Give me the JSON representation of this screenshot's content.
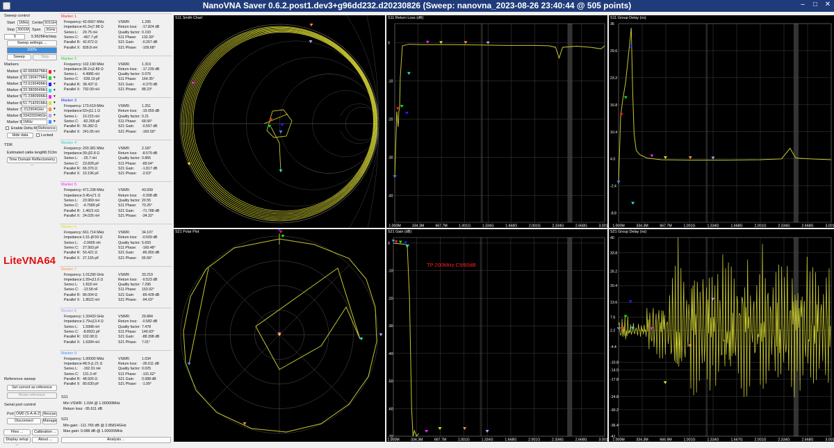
{
  "window": {
    "title": "NanoVNA Saver 0.6.2.post1.dev3+g96dd232.d20230826 (Sweep: nanovna_2023-08-26 23:40:44 @ 505 points)"
  },
  "sweep": {
    "section_label": "Sweep control",
    "start_label": "Start",
    "start_value": "1MHz",
    "center_label": "Center",
    "center_value": "501GHz",
    "stop_label": "Stop",
    "stop_value": "3001MH",
    "span_label": "Span",
    "span_value": "3GHz",
    "count_value": "5",
    "step_value": "5.952MHz/step",
    "settings_button": "Sweep settings ...",
    "progress_text": "100%",
    "progress_fraction": 1.0,
    "sweep_button": "Sweep",
    "stop_button": "Stop"
  },
  "markers_panel": {
    "section_label": "Markers",
    "rows": [
      {
        "label": "Marker 1",
        "value": "42.666667MHz",
        "color": "#ff2020"
      },
      {
        "label": "Marker 2",
        "value": "32.190477MHz",
        "color": "#20e020"
      },
      {
        "label": "Marker 3",
        "value": "73.619049MHz",
        "color": "#2020ff"
      },
      {
        "label": "Marker 4",
        "value": "33.380954MHz",
        "color": "#20e0e0"
      },
      {
        "label": "Marker 5",
        "value": "71.238099MHz",
        "color": "#ff20ff"
      },
      {
        "label": "Marker 6",
        "value": "51.714291MHz",
        "color": "#e0e020"
      },
      {
        "label": "Marker 7",
        "value": ".012904GHz",
        "color": "#ff9040"
      },
      {
        "label": "Marker 8",
        "value": "334333346GHz",
        "color": "#c0a0ff"
      },
      {
        "label": "Marker 9",
        "value": "1MHz",
        "color": "#4090ff"
      }
    ],
    "enable_delta": "Enable Delta M",
    "reference": "Reference",
    "hide_data": "Hide data",
    "locked": "Locked"
  },
  "tdr": {
    "section_label": "TDR",
    "cable_label": "Estimated cable length:",
    "cable_value": "0.313m",
    "tdr_button": "Time Domain Reflectometry ..."
  },
  "brand": {
    "text": "LiteVNA64"
  },
  "reference_sweep": {
    "section_label": "Reference sweep",
    "set_button": "Set current as reference",
    "reset_button": "Reset reference"
  },
  "serial": {
    "section_label": "Serial port control",
    "port_label": "Port",
    "port_value": "OM0 (S-A-A-2)",
    "rescan": "Rescan",
    "disconnect": "Disconnect",
    "manage": "Manage"
  },
  "bottom_buttons": {
    "files": "Files ...",
    "calibration": "Calibration ...",
    "display": "Display setup ...",
    "about": "About ...",
    "analysis": "Analysis ..."
  },
  "marker_details": [
    {
      "title": "Marker 1",
      "color": "#ff2020",
      "left": [
        [
          "Frequency:",
          "42.6667 MHz"
        ],
        [
          "Impedance:",
          "41.3+j7.98 Ω"
        ],
        [
          "Series L:",
          "29.75 nH"
        ],
        [
          "Series C:",
          "-467.7 pF"
        ],
        [
          "Parallel R:",
          "42.872 Ω"
        ],
        [
          "Parallel X:",
          "828.8 nH"
        ]
      ],
      "right": [
        [
          "VSWR:",
          "1.295"
        ],
        [
          "Return loss:",
          "-17.824 dB"
        ],
        [
          "Quality factor:",
          "0.193"
        ],
        [
          "S11 Phase:",
          "132.39°"
        ],
        [
          "S21 Gain:",
          "-0.267 dB"
        ],
        [
          "S21 Phase:",
          "-109.68°"
        ]
      ]
    },
    {
      "title": "Marker 2",
      "color": "#20d020",
      "left": [
        [
          "Frequency:",
          "102.190 MHz"
        ],
        [
          "Impedance:",
          "38.2+j2.89 Ω"
        ],
        [
          "Series L:",
          "4.4986 nH"
        ],
        [
          "Series C:",
          "-539.19 pF"
        ],
        [
          "Parallel R:",
          "38.437 Ω"
        ],
        [
          "Parallel X:",
          "792.09 nH"
        ]
      ],
      "right": [
        [
          "VSWR:",
          "1.319"
        ],
        [
          "Return loss:",
          "-17.239 dB"
        ],
        [
          "Quality factor:",
          "0.076"
        ],
        [
          "S11 Phase:",
          "164.35°"
        ],
        [
          "S21 Gain:",
          "-0.370 dB"
        ],
        [
          "S21 Phase:",
          "88.23°"
        ]
      ]
    },
    {
      "title": "Marker 3",
      "color": "#2020ff",
      "left": [
        [
          "Frequency:",
          "173.619 MHz"
        ],
        [
          "Impedance:",
          "53+j11.1 Ω"
        ],
        [
          "Series L:",
          "10.215 nH"
        ],
        [
          "Series C:",
          "-82.265 pF"
        ],
        [
          "Parallel R:",
          "55.382 Ω"
        ],
        [
          "Parallel X:",
          "241.65 nH"
        ]
      ],
      "right": [
        [
          "VSWR:",
          "1.251"
        ],
        [
          "Return loss:",
          "-19.059 dB"
        ],
        [
          "Quality factor:",
          "0.21"
        ],
        [
          "S11 Phase:",
          "68.56°"
        ],
        [
          "S21 Gain:",
          "-0.557 dB"
        ],
        [
          "S21 Phase:",
          "-160.59°"
        ]
      ]
    },
    {
      "title": "Marker 4",
      "color": "#20d0d0",
      "left": [
        [
          "Frequency:",
          "203.381 MHz"
        ],
        [
          "Impedance:",
          "39-j32.8 Ω"
        ],
        [
          "Series L:",
          "-25.7 nH"
        ],
        [
          "Series C:",
          "23.828 pF"
        ],
        [
          "Parallel R:",
          "66.376 Ω"
        ],
        [
          "Parallel X:",
          "10.196 pF"
        ]
      ],
      "right": [
        [
          "VSWR:",
          "2.187"
        ],
        [
          "Return loss:",
          "-8.579 dB"
        ],
        [
          "Quality factor:",
          "0.865"
        ],
        [
          "S11 Phase:",
          "-89.64°"
        ],
        [
          "S21 Gain:",
          "-1.817 dB"
        ],
        [
          "S21 Phase:",
          "-2.63°"
        ]
      ]
    },
    {
      "title": "Marker 5",
      "color": "#ff20ff",
      "left": [
        [
          "Frequency:",
          "471.238 MHz"
        ],
        [
          "Impedance:",
          "3.45+j71 Ω"
        ],
        [
          "Series L:",
          "23.969 nH"
        ],
        [
          "Series C:",
          "-4.7589 pF"
        ],
        [
          "Parallel R:",
          "1.4621 kΩ"
        ],
        [
          "Parallel X:",
          "24.026 nH"
        ]
      ],
      "right": [
        [
          "VSWR:",
          "43.699"
        ],
        [
          "Return loss:",
          "-0.398 dB"
        ],
        [
          "Quality factor:",
          "20.55"
        ],
        [
          "S11 Phase:",
          "70.25°"
        ],
        [
          "S21 Gain:",
          "-71.788 dB"
        ],
        [
          "S21 Phase:",
          "-34.32°"
        ]
      ]
    },
    {
      "title": "Marker 6",
      "color": "#e0e020",
      "left": [
        [
          "Frequency:",
          "661.714 MHz"
        ],
        [
          "Impedance:",
          "1.51-j8.59 Ω"
        ],
        [
          "Series L:",
          "-2.0665 nH"
        ],
        [
          "Series C:",
          "27.993 pF"
        ],
        [
          "Parallel R:",
          "50.421 Ω"
        ],
        [
          "Parallel X:",
          "27.155 pF"
        ]
      ],
      "right": [
        [
          "VSWR:",
          "34.107"
        ],
        [
          "Return loss:",
          "-0.509 dB"
        ],
        [
          "Quality factor:",
          "5.693"
        ],
        [
          "S11 Phase:",
          "-160.48°"
        ],
        [
          "S21 Gain:",
          "-86.950 dB"
        ],
        [
          "S21 Phase:",
          "65.56°"
        ]
      ]
    },
    {
      "title": "Marker 7",
      "color": "#ff9040",
      "left": [
        [
          "Frequency:",
          "1.01290 GHz"
        ],
        [
          "Impedance:",
          "1.59+j11.6 Ω"
        ],
        [
          "Series L:",
          "1.818 nH"
        ],
        [
          "Series C:",
          "-13.58 nF"
        ],
        [
          "Parallel R:",
          "86.004 Ω"
        ],
        [
          "Parallel X:",
          "1.8522 nH"
        ]
      ],
      "right": [
        [
          "VSWR:",
          "33.219"
        ],
        [
          "Return loss:",
          "-0.523 dB"
        ],
        [
          "Quality factor:",
          "7.296"
        ],
        [
          "S11 Phase:",
          "153.92°"
        ],
        [
          "S21 Gain:",
          "-89.428 dB"
        ],
        [
          "S21 Phase:",
          "-94.03°"
        ]
      ]
    },
    {
      "title": "Marker 8",
      "color": "#b090f0",
      "left": [
        [
          "Frequency:",
          "1.33433 GHz"
        ],
        [
          "Impedance:",
          "1.79+j13.4 Ω"
        ],
        [
          "Series L:",
          "1.5998 nH"
        ],
        [
          "Series C:",
          "-8.8931 pF"
        ],
        [
          "Parallel R:",
          "102.08 Ω"
        ],
        [
          "Parallel X:",
          "1.6284 nH"
        ]
      ],
      "right": [
        [
          "VSWR:",
          "29.884"
        ],
        [
          "Return loss:",
          "-0.582 dB"
        ],
        [
          "Quality factor:",
          "7.478"
        ],
        [
          "S11 Phase:",
          "149.93°"
        ],
        [
          "S21 Gain:",
          "-88.398 dB"
        ],
        [
          "S21 Phase:",
          "7.01°"
        ]
      ]
    },
    {
      "title": "Marker 9",
      "color": "#4090ff",
      "left": [
        [
          "Frequency:",
          "1.00000 MHz"
        ],
        [
          "Impedance:",
          "48.9-j1.21 Ω"
        ],
        [
          "Series L:",
          "-192.91 nH"
        ],
        [
          "Series C:",
          "131.3 nF"
        ],
        [
          "Parallel R:",
          "48.926 Ω"
        ],
        [
          "Parallel X:",
          "80.639 pF"
        ]
      ],
      "right": [
        [
          "VSWR:",
          "1.034"
        ],
        [
          "Return loss:",
          "-35.611 dB"
        ],
        [
          "Quality factor:",
          "0.025"
        ],
        [
          "S11 Phase:",
          "-131.62°"
        ],
        [
          "S21 Gain:",
          "0.088 dB"
        ],
        [
          "S21 Phase:",
          "-1.99°"
        ]
      ]
    }
  ],
  "s11_summary": {
    "section_label": "S11",
    "min_vswr": "Min VSWR:  1.034 @ 1.00000MHz",
    "return_loss": "Return loss:  -35.611 dB"
  },
  "s21_summary": {
    "section_label": "S21",
    "min_gain": "Min gain:  -111.765 dB @ 2.85814GHz",
    "max_gain": "Max gain:  0.088 dB @ 1.00000MHz"
  },
  "chart_data": [
    {
      "type": "smith",
      "title": "S11 Smith Chart"
    },
    {
      "type": "line",
      "title": "S11 Return Loss (dB)",
      "xticks": [
        "1.000M",
        "334.3M",
        "667.7M",
        "1.001G",
        "1.334G",
        "1.668G",
        "2.001G",
        "2.334G",
        "2.668G",
        "3.001G"
      ],
      "yticks": [
        "0",
        "-10",
        "-20",
        "-30",
        "-40"
      ],
      "ylim": [
        -47,
        5
      ],
      "x": [
        1,
        30,
        40,
        50,
        60,
        70,
        80,
        110,
        200,
        400,
        800,
        1200,
        1600,
        2000,
        2200,
        2300,
        2350,
        2400,
        2600,
        2800,
        2950,
        3001
      ],
      "y": [
        -35,
        -18,
        -20,
        -22,
        -18,
        -17,
        -9,
        -0.8,
        -0.4,
        -0.5,
        -0.5,
        -0.6,
        -0.7,
        -0.7,
        -0.8,
        -1.2,
        -4,
        -1.2,
        -0.9,
        -1.2,
        -1.6,
        -0.8
      ]
    },
    {
      "type": "line",
      "title": "S11 Group Delay (ns)",
      "xticks": [
        "1.000M",
        "334.3M",
        "667.7M",
        "1.001G",
        "1.334G",
        "1.668G",
        "2.001G",
        "2.334G",
        "2.668G",
        "3.001G"
      ],
      "yticks": [
        "36",
        "29.6",
        "23.2",
        "16.8",
        "10.4",
        "4.0",
        "-2.4",
        "-8.8"
      ],
      "ylim": [
        -11,
        36
      ],
      "x": [
        1,
        30,
        60,
        100,
        150,
        180,
        200,
        220,
        250,
        300,
        400,
        600,
        1000,
        1500,
        2000,
        2300,
        2420,
        2500,
        2700,
        3001
      ],
      "y": [
        -2,
        14,
        18,
        22,
        30,
        35,
        20,
        10,
        6,
        5,
        4.2,
        3.8,
        3.7,
        3.7,
        3.8,
        4,
        6.5,
        4.2,
        4,
        3.8
      ]
    },
    {
      "type": "polar",
      "title": "S21 Polar Plot"
    },
    {
      "type": "line",
      "title": "S21 Gain (dB)",
      "annotation": "TP 200MHz C9/60dB",
      "xticks": [
        "1.000M",
        "334.3M",
        "667.7M",
        "1.001G",
        "1.334G",
        "1.668G",
        "2.001G",
        "2.334G",
        "2.668G",
        "3.001G"
      ],
      "yticks": [
        "0",
        "-10",
        "-20",
        "-30",
        "-40",
        "-50",
        "-60",
        "-70"
      ],
      "ylim": [
        -70,
        2
      ],
      "x": [
        1,
        100,
        180,
        200,
        230,
        260,
        280,
        300,
        330,
        360
      ],
      "y": [
        0,
        -0.3,
        -0.5,
        -1.8,
        -20,
        -60,
        -70,
        -68,
        -70,
        -69
      ]
    },
    {
      "type": "line",
      "title": "S21 Group Delay (ns)",
      "xticks": [
        "1.000M",
        "334.3M",
        "666.9M",
        "1.001G",
        "1.334G",
        "1.667G",
        "2.001G",
        "2.334G",
        "2.668G",
        "3.001G"
      ],
      "yticks": [
        "40",
        "33.8",
        "26.2",
        "20.4",
        "13.6",
        "7.6",
        "2.2",
        "-4.4",
        "-10.8",
        "-14.0",
        "-17.8",
        "-24.8",
        "-30.2",
        "-36.4",
        "-41"
      ],
      "ylim": [
        -41,
        40
      ]
    }
  ]
}
